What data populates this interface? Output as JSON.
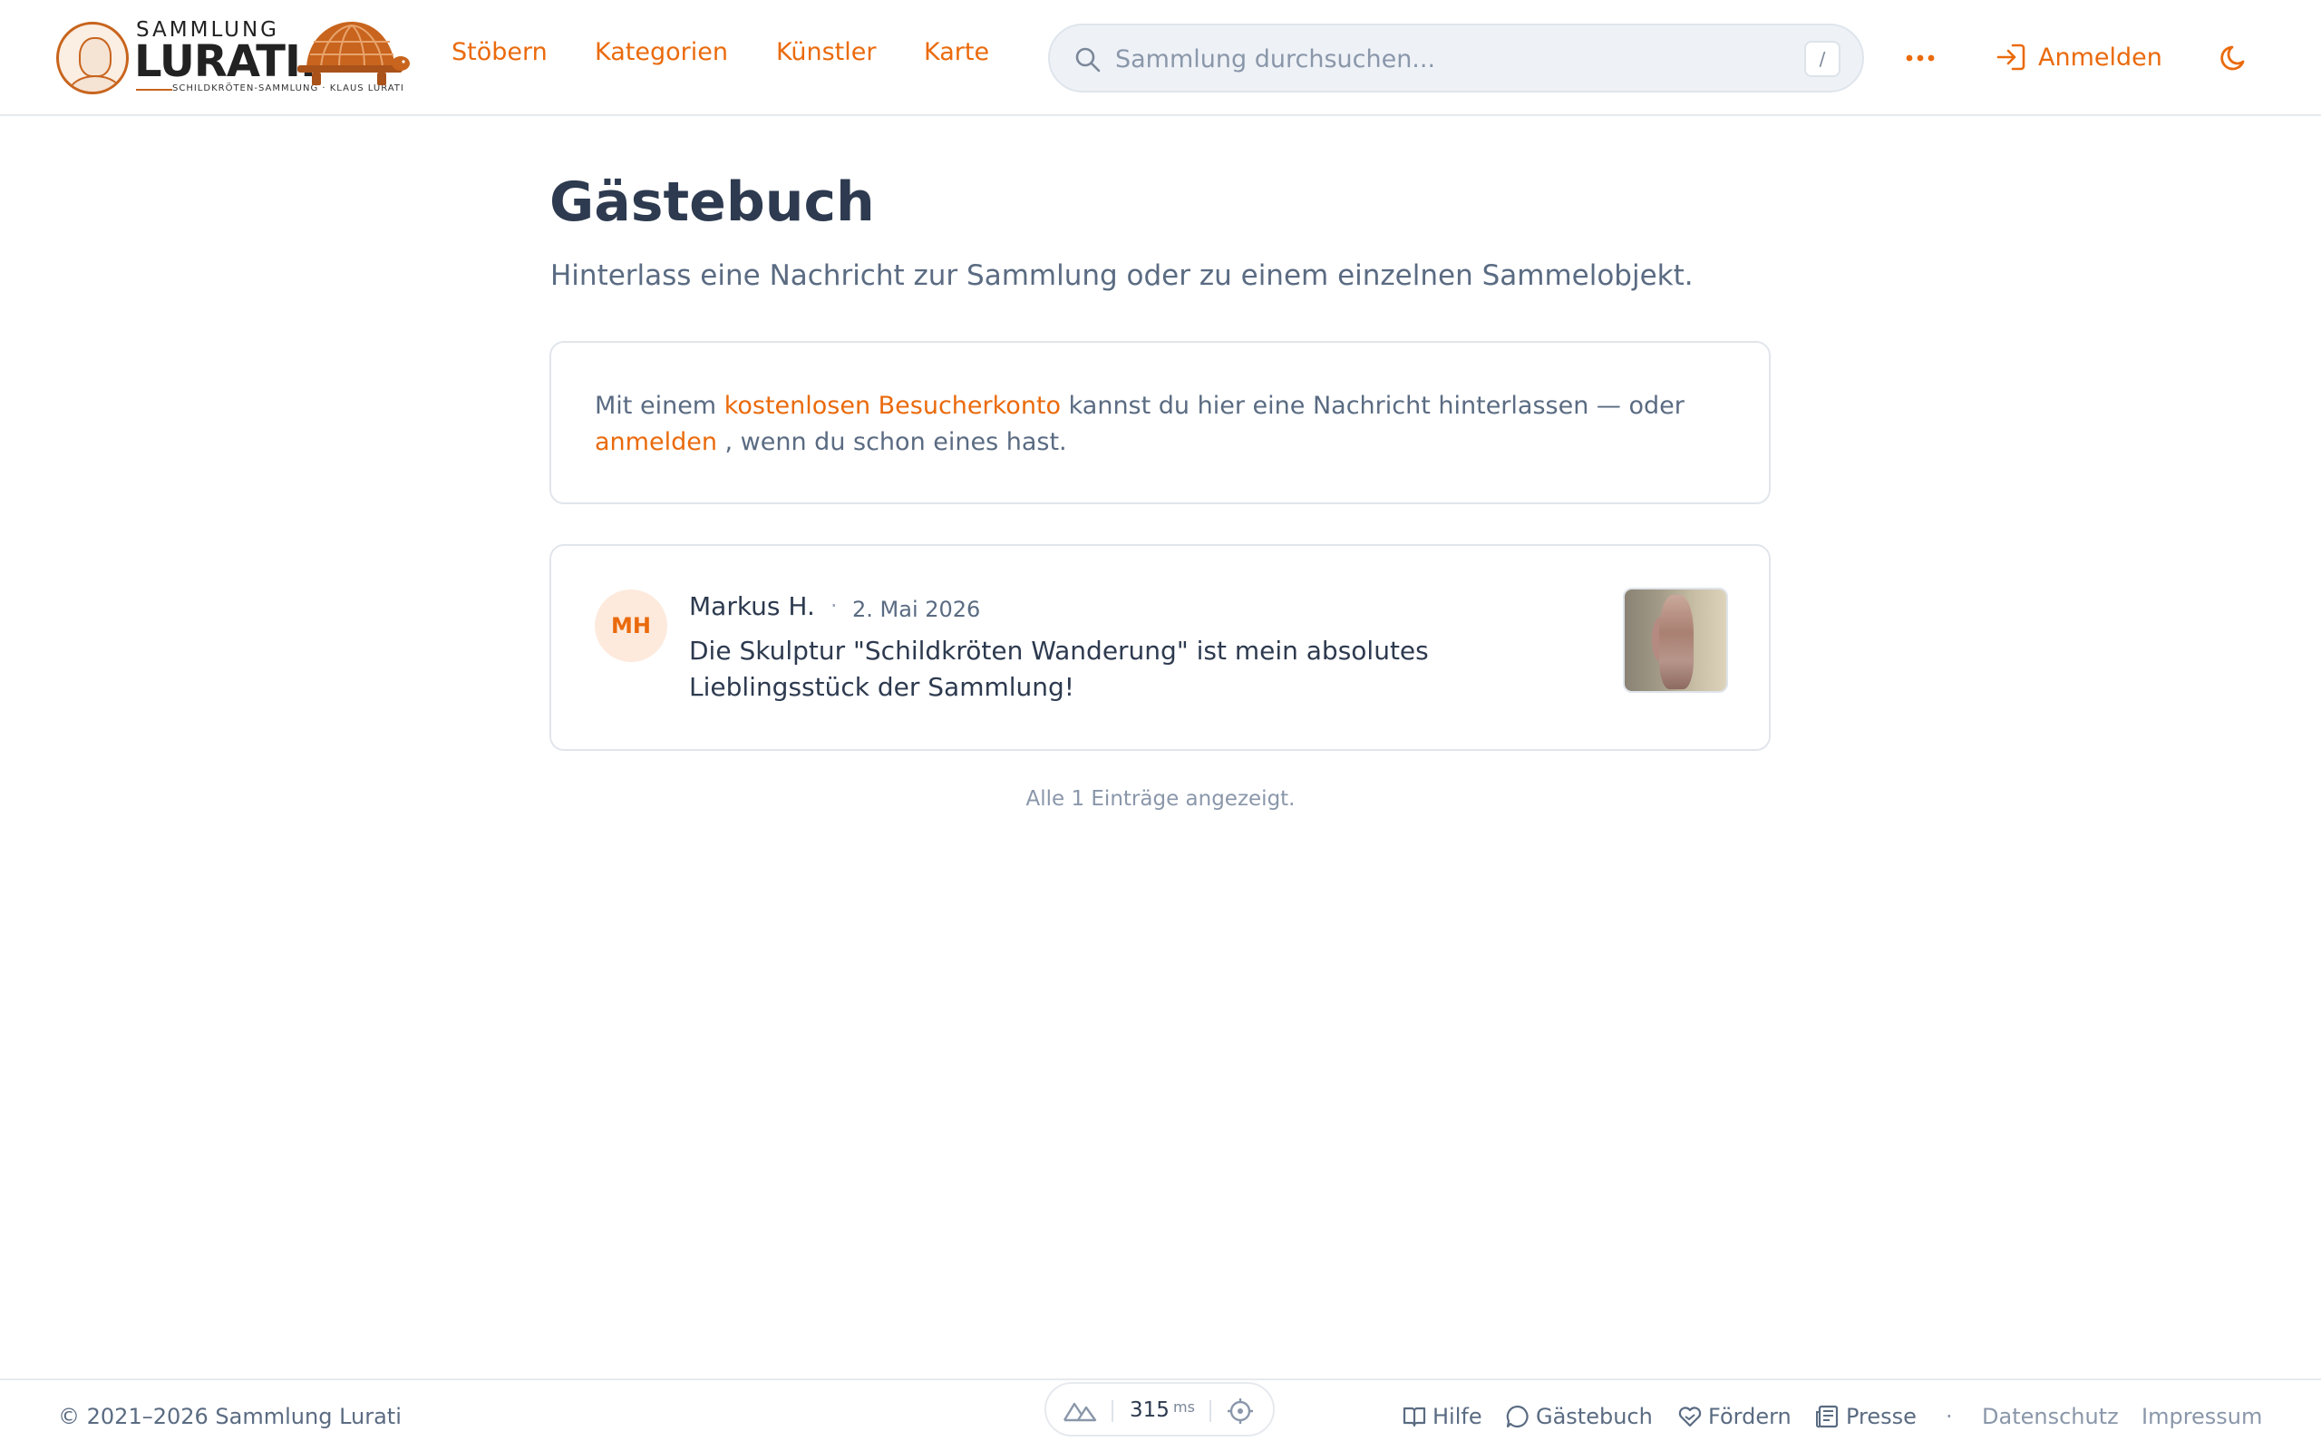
{
  "brand": {
    "top": "SAMMLUNG",
    "main": "LURATI.",
    "tagline": "SCHILDKRÖTEN-SAMMLUNG · KLAUS LURATI"
  },
  "nav": {
    "items": [
      "Stöbern",
      "Kategorien",
      "Künstler",
      "Karte"
    ]
  },
  "search": {
    "placeholder": "Sammlung durchsuchen...",
    "shortcut": "/"
  },
  "header": {
    "login_label": "Anmelden"
  },
  "page": {
    "title": "Gästebuch",
    "subtitle": "Hinterlass eine Nachricht zur Sammlung oder zu einem einzelnen Sammelobjekt."
  },
  "info": {
    "pre": "Mit einem ",
    "link_account": "kostenlosen Besucherkonto",
    "mid": " kannst du hier eine Nachricht hinterlassen — oder ",
    "link_login": "anmelden",
    "post": " , wenn du schon eines hast."
  },
  "entries": [
    {
      "initials": "MH",
      "name": "Markus H.",
      "separator": "·",
      "date": "2. Mai 2026",
      "text": "Die Skulptur \"Schildkröten Wanderung\" ist mein absolutes Lieblingsstück der Sammlung!"
    }
  ],
  "list_status": "Alle 1 Einträge angezeigt.",
  "footer": {
    "copyright": "© 2021–2026 Sammlung Lurati",
    "perf_value": "315",
    "perf_unit": "ms",
    "links": [
      "Hilfe",
      "Gästebuch",
      "Fördern",
      "Presse"
    ],
    "separator": "·",
    "legal": [
      "Datenschutz",
      "Impressum"
    ]
  },
  "colors": {
    "accent": "#ea6a0c",
    "text": "#2d3a4f",
    "muted": "#5a6b82"
  },
  "icons": [
    "search-icon",
    "more-icon",
    "login-icon",
    "moon-icon",
    "mountain-icon",
    "crosshair-icon",
    "book-icon",
    "chat-icon",
    "heart-hand-icon",
    "newspaper-icon"
  ]
}
